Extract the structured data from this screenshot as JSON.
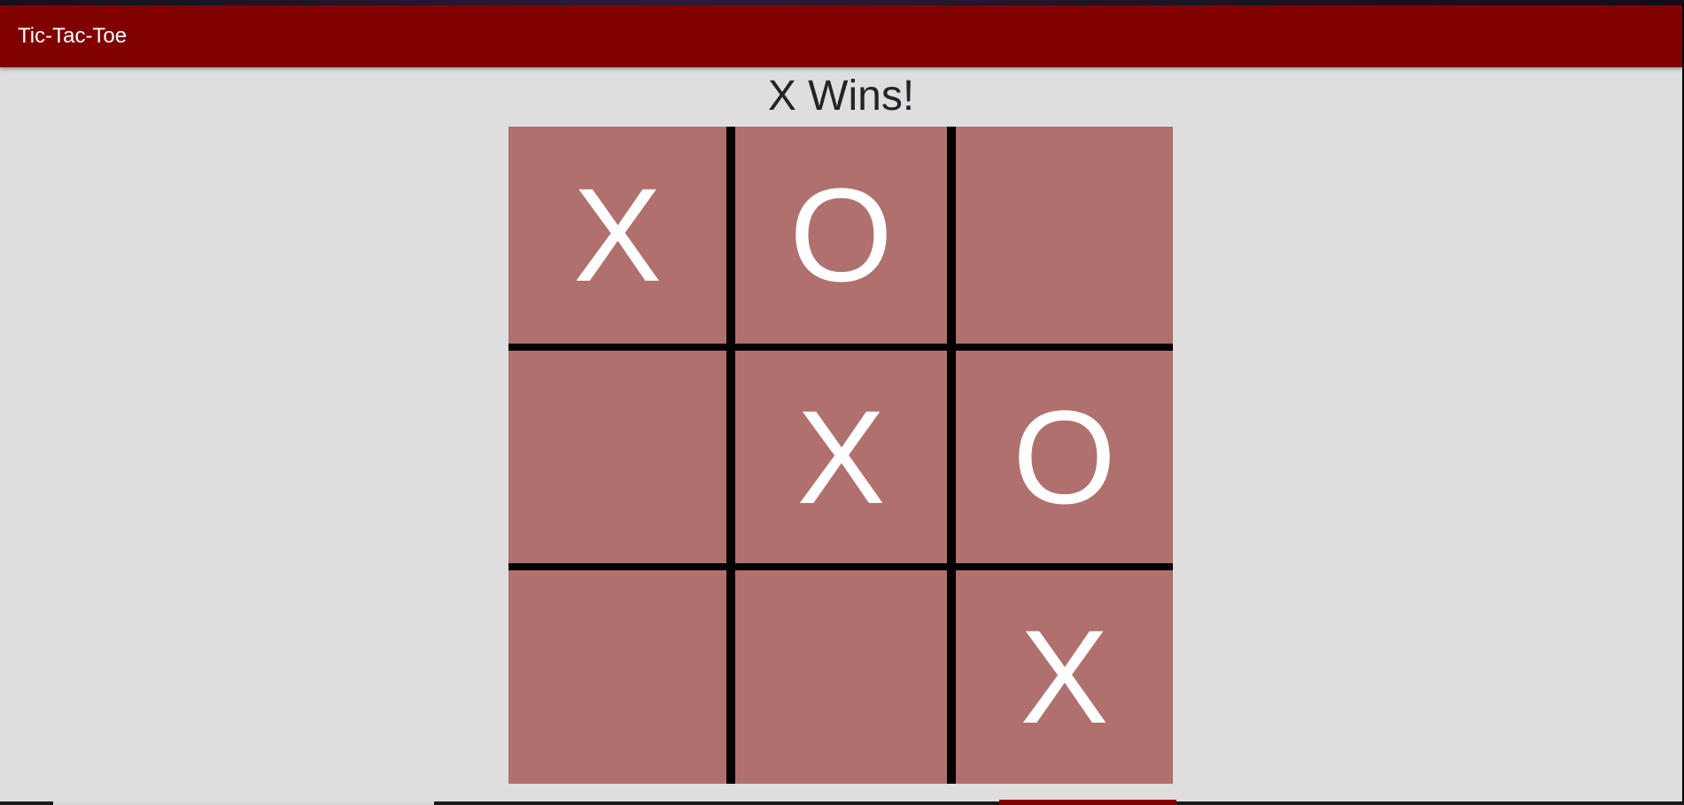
{
  "app": {
    "title": "Tic-Tac-Toe"
  },
  "game": {
    "status": "X Wins!",
    "board": [
      "X",
      "O",
      "",
      "",
      "X",
      "O",
      "",
      "",
      "X"
    ]
  },
  "colors": {
    "navbar": "#800000",
    "background": "#dedede",
    "cell": "#b0706e",
    "grid_line": "#000000",
    "mark": "#ffffff",
    "status_text": "#212529"
  }
}
